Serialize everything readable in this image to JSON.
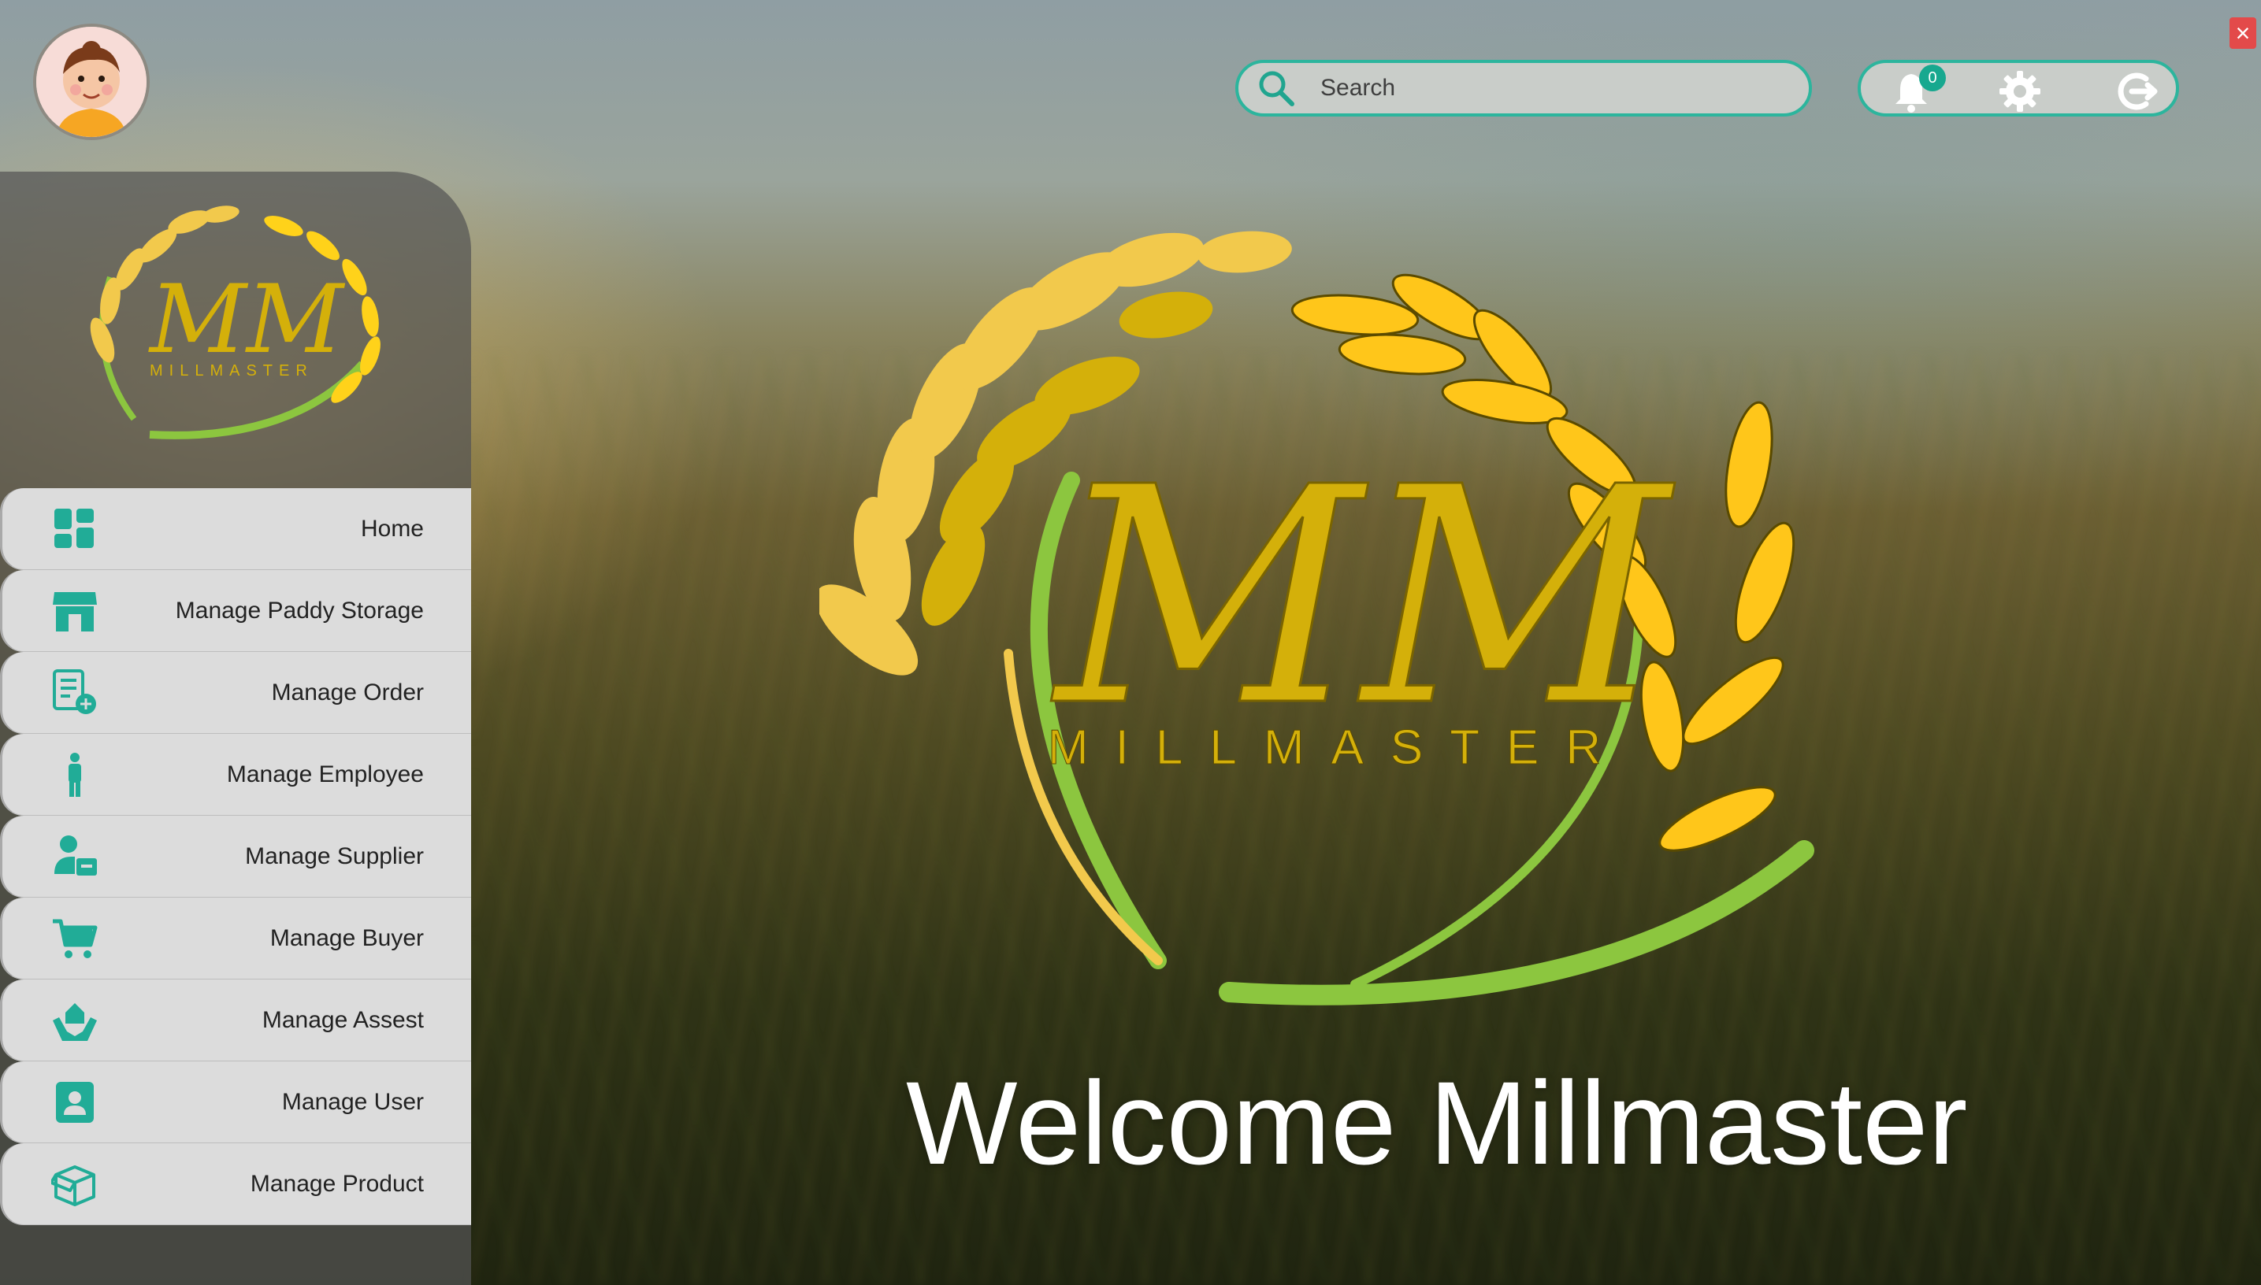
{
  "app": {
    "welcome_text": "Welcome Millmaster",
    "logo_initials": "MM",
    "logo_wordmark": "MILLMASTER"
  },
  "header": {
    "search_placeholder": "Search",
    "notification_count": "0"
  },
  "sidebar": {
    "items": [
      {
        "label": "Home",
        "icon": "dashboard-grid-icon"
      },
      {
        "label": "Manage Paddy Storage",
        "icon": "storefront-icon"
      },
      {
        "label": "Manage Order",
        "icon": "order-add-icon"
      },
      {
        "label": "Manage Employee",
        "icon": "person-standing-icon"
      },
      {
        "label": "Manage Supplier",
        "icon": "supplier-card-icon"
      },
      {
        "label": "Manage Buyer",
        "icon": "shopping-cart-icon"
      },
      {
        "label": "Manage Assest",
        "icon": "hand-holding-house-icon"
      },
      {
        "label": "Manage User",
        "icon": "user-badge-icon"
      },
      {
        "label": "Manage Product",
        "icon": "box-icon"
      }
    ]
  },
  "colors": {
    "accent": "#2cb59d",
    "icon": "#21ac97",
    "menu_bg": "#dcdcdc",
    "close": "#e34a4a",
    "logo_gold": "#d4b00a",
    "logo_green": "#8cc63f"
  }
}
